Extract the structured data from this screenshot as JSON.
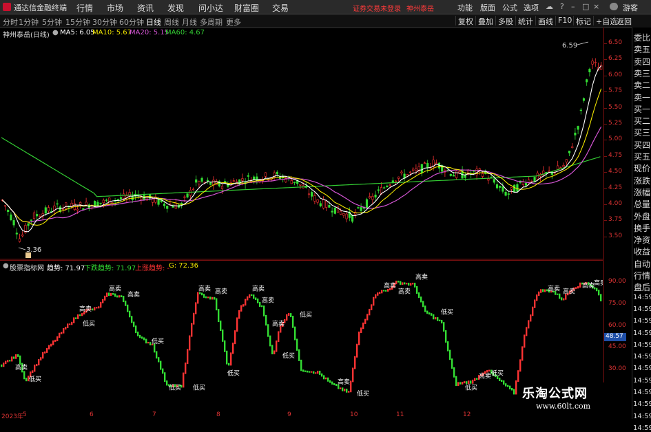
{
  "menubar": {
    "app_title": "通达信金融终端",
    "items": [
      "行情",
      "市场",
      "资讯",
      "发现",
      "问小达",
      "财富圈",
      "交易"
    ],
    "notice": "证券交易未登录",
    "notice_user": "神州泰岳",
    "right_items": [
      "功能",
      "版面",
      "公式",
      "选项"
    ],
    "guest": "游客"
  },
  "tabs": {
    "periods": [
      "分时",
      "1分钟",
      "5分钟",
      "15分钟",
      "30分钟",
      "60分钟",
      "日线",
      "周线",
      "月线",
      "多周期",
      "更多"
    ],
    "active": "日线",
    "right_buttons": [
      "复权",
      "叠加",
      "多股",
      "统计",
      "画线",
      "F10",
      "标记",
      "+自选",
      "返回"
    ]
  },
  "main_legend": {
    "stock": "神州泰岳(日线)",
    "ma5": "MA5: 6.05",
    "ma10": "MA10: 5.67",
    "ma20": "MA20: 5.15",
    "ma60": "MA60: 4.67"
  },
  "main_annotations": {
    "high": "6.59",
    "low": "3.36"
  },
  "price_ticks": [
    "6.50",
    "6.25",
    "6.00",
    "5.75",
    "5.50",
    "5.25",
    "5.00",
    "4.75",
    "4.50",
    "4.25",
    "4.00",
    "3.75",
    "3.50"
  ],
  "indicator_legend": {
    "name": "股票指标网",
    "trend": "趋势: 71.97",
    "down": "下跌趋势: 71.97",
    "up": "上涨趋势: -",
    "g": "G: 72.36"
  },
  "indicator_ticks": [
    "90.00",
    "75.00",
    "60.00",
    "45.00",
    "30.00"
  ],
  "indicator_current": "48.57",
  "labels": {
    "high_sell": "高卖",
    "low_buy": "低买"
  },
  "x_labels": [
    "2023年",
    "5",
    "6",
    "7",
    "8",
    "9",
    "10",
    "11",
    "12"
  ],
  "sidebar": [
    "委比",
    "卖五",
    "卖四",
    "卖三",
    "卖二",
    "卖一",
    "买一",
    "买二",
    "买三",
    "买四",
    "买五",
    "现价",
    "涨跌",
    "涨幅",
    "总量",
    "外盘",
    "换手",
    "净资",
    "收益",
    "自动",
    "行情",
    "盘后",
    "14:59",
    "14:59",
    "14:59",
    "14:59",
    "14:59",
    "14:59",
    "14:59",
    "14:59",
    "14:59",
    "14:59",
    "14:59",
    "14:59"
  ],
  "watermark": {
    "title": "乐淘公式网",
    "url": "www.60lt.com"
  },
  "colors": {
    "up": "#ff3333",
    "down": "#33dd33",
    "ma5": "#ffffff",
    "ma10": "#f2e600",
    "ma20": "#d455d4",
    "ma60": "#33cc33",
    "axis": "#7a1010"
  }
}
